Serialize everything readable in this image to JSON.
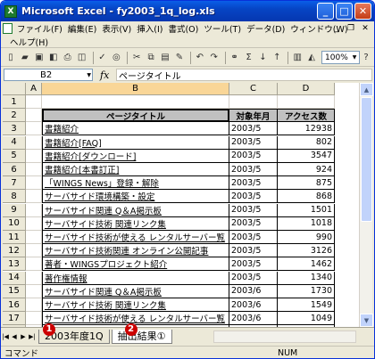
{
  "window": {
    "title": "Microsoft Excel - fy2003_1q_log.xls",
    "app_icon": "X"
  },
  "menu": {
    "items": [
      "ファイル(F)",
      "編集(E)",
      "表示(V)",
      "挿入(I)",
      "書式(O)",
      "ツール(T)",
      "データ(D)",
      "ウィンドウ(W)"
    ],
    "help": "ヘルプ(H)"
  },
  "toolbar": {
    "zoom": "100%",
    "sigma": "Σ"
  },
  "formula": {
    "cell_ref": "B2",
    "fx": "fx",
    "value": "ページタイトル"
  },
  "columns": [
    "A",
    "B",
    "C",
    "D"
  ],
  "table": {
    "headers": [
      "ページタイトル",
      "対象年月",
      "アクセス数"
    ],
    "rows": [
      [
        "書籍紹介",
        "2003/5",
        "12938"
      ],
      [
        "書籍紹介[FAQ]",
        "2003/5",
        "802"
      ],
      [
        "書籍紹介[ダウンロード]",
        "2003/5",
        "3547"
      ],
      [
        "書籍紹介[本書訂正]",
        "2003/5",
        "924"
      ],
      [
        "「WINGS News」登録・解除",
        "2003/5",
        "875"
      ],
      [
        "サーバサイド環境構築・設定",
        "2003/5",
        "868"
      ],
      [
        "サーバサイド関連 Q＆A掲示板",
        "2003/5",
        "1501"
      ],
      [
        "サーバサイド技術 関連リンク集",
        "2003/5",
        "1018"
      ],
      [
        "サーバサイド技術が使える レンタルサーバー覧",
        "2003/5",
        "990"
      ],
      [
        "サーバサイド技術関連 オンライン公開記事",
        "2003/5",
        "3126"
      ],
      [
        "著者・WINGSプロジェクト紹介",
        "2003/5",
        "1462"
      ],
      [
        "著作権情報",
        "2003/5",
        "1340"
      ],
      [
        "サーバサイド関連 Q＆A掲示板",
        "2003/6",
        "1730"
      ],
      [
        "サーバサイド技術 関連リンク集",
        "2003/6",
        "1549"
      ],
      [
        "サーバサイド技術が使える レンタルサーバー覧",
        "2003/6",
        "1049"
      ],
      [
        "サーバサイド技術関連 オンライン公開記事",
        "2003/6",
        "2088"
      ]
    ]
  },
  "sheets": {
    "tabs": [
      "2003年度1Q",
      "抽出結果①"
    ],
    "markers": [
      "1",
      "2"
    ]
  },
  "status": {
    "mode": "コマンド",
    "num": "NUM"
  }
}
